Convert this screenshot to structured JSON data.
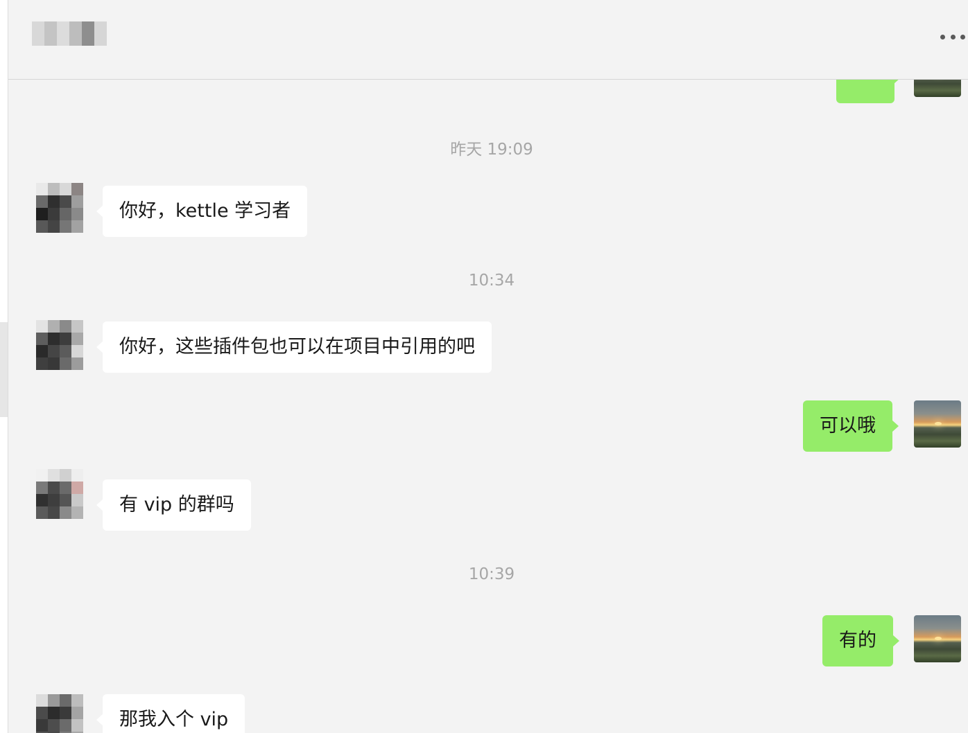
{
  "colors": {
    "background": "#f3f3f3",
    "incoming_bubble": "#ffffff",
    "outgoing_bubble": "#95ec69",
    "timestamp_text": "#a6a6a6",
    "message_text": "#191919"
  },
  "header": {
    "more_icon": "more-horizontal-icon"
  },
  "messages": [
    {
      "type": "time",
      "text": "昨天 19:09"
    },
    {
      "type": "in",
      "text": "你好，kettle 学习者"
    },
    {
      "type": "time",
      "text": "10:34"
    },
    {
      "type": "in",
      "text": "你好，这些插件包也可以在项目中引用的吧"
    },
    {
      "type": "out",
      "text": "可以哦"
    },
    {
      "type": "in",
      "text": "有 vip 的群吗"
    },
    {
      "type": "time",
      "text": "10:39"
    },
    {
      "type": "out",
      "text": "有的"
    },
    {
      "type": "in",
      "text": "那我入个 vip"
    }
  ]
}
